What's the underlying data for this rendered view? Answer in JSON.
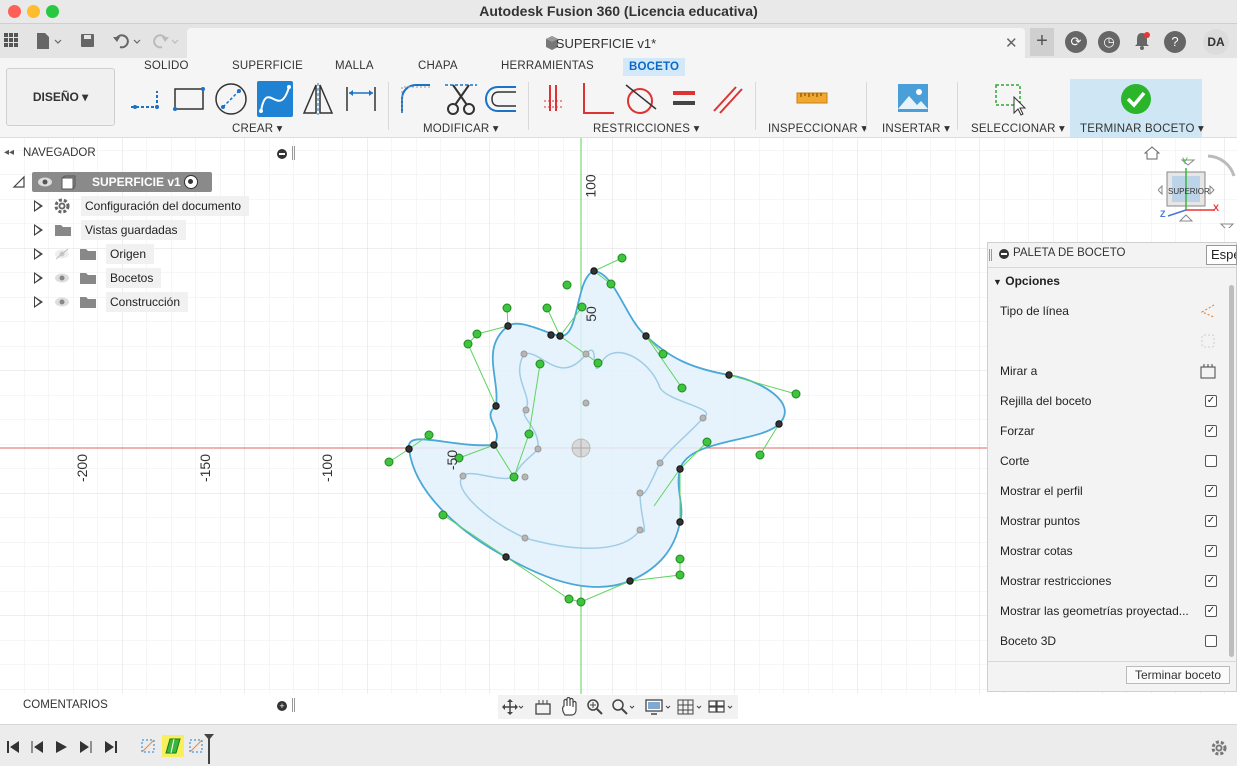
{
  "window": {
    "title": "Autodesk Fusion 360 (Licencia educativa)",
    "document_tab": "SUPERFICIE v1*",
    "user_initials": "DA"
  },
  "workspace_tabs": [
    "SOLIDO",
    "SUPERFICIE",
    "MALLA",
    "CHAPA",
    "HERRAMIENTAS",
    "BOCETO"
  ],
  "active_tab": "BOCETO",
  "design_button": "DISEÑO",
  "tool_groups": {
    "crear": "CREAR",
    "modificar": "MODIFICAR",
    "restricciones": "RESTRICCIONES",
    "inspeccionar": "INSPECCIONAR",
    "insertar": "INSERTAR",
    "seleccionar": "SELECCIONAR",
    "terminar": "TERMINAR BOCETO"
  },
  "navigator": {
    "title": "NAVEGADOR",
    "root": "SUPERFICIE v1",
    "items": [
      "Configuración del documento",
      "Vistas guardadas",
      "Origen",
      "Bocetos",
      "Construcción"
    ]
  },
  "viewcube": {
    "face": "SUPERIOR",
    "axis_y": "Y",
    "axis_x": "X",
    "axis_z": "Z"
  },
  "axis_labels": {
    "v100": "100",
    "v50": "50",
    "h_200": "-200",
    "h_150": "-150",
    "h_100": "-100",
    "h_50": "-50"
  },
  "palette": {
    "title": "PALETA DE BOCETO",
    "section": "Opciones",
    "tooltip_partial": "Espe",
    "rows": [
      {
        "label": "Tipo de línea",
        "type": "icon"
      },
      {
        "label": "",
        "type": "icon-disabled"
      },
      {
        "label": "Mirar a",
        "type": "icon"
      },
      {
        "label": "Rejilla del boceto",
        "type": "checkbox",
        "checked": true
      },
      {
        "label": "Forzar",
        "type": "checkbox",
        "checked": true
      },
      {
        "label": "Corte",
        "type": "checkbox",
        "checked": false
      },
      {
        "label": "Mostrar el perfil",
        "type": "checkbox",
        "checked": true
      },
      {
        "label": "Mostrar puntos",
        "type": "checkbox",
        "checked": true
      },
      {
        "label": "Mostrar cotas",
        "type": "checkbox",
        "checked": true
      },
      {
        "label": "Mostrar restricciones",
        "type": "checkbox",
        "checked": true
      },
      {
        "label": "Mostrar las geometrías proyectad...",
        "type": "checkbox",
        "checked": true
      },
      {
        "label": "Boceto 3D",
        "type": "checkbox",
        "checked": false
      }
    ],
    "finish_button": "Terminar boceto"
  },
  "comments": "COMENTARIOS",
  "colors": {
    "accent": "#0a69c7",
    "active_tab_bg": "#d3e8f9",
    "curve": "#4aa8d8",
    "profile_fill": "#e3f1fb",
    "handle": "#3ec43e",
    "axis_x": "#e06666",
    "axis_y": "#5bd25b",
    "finish_green": "#2ab52a"
  }
}
